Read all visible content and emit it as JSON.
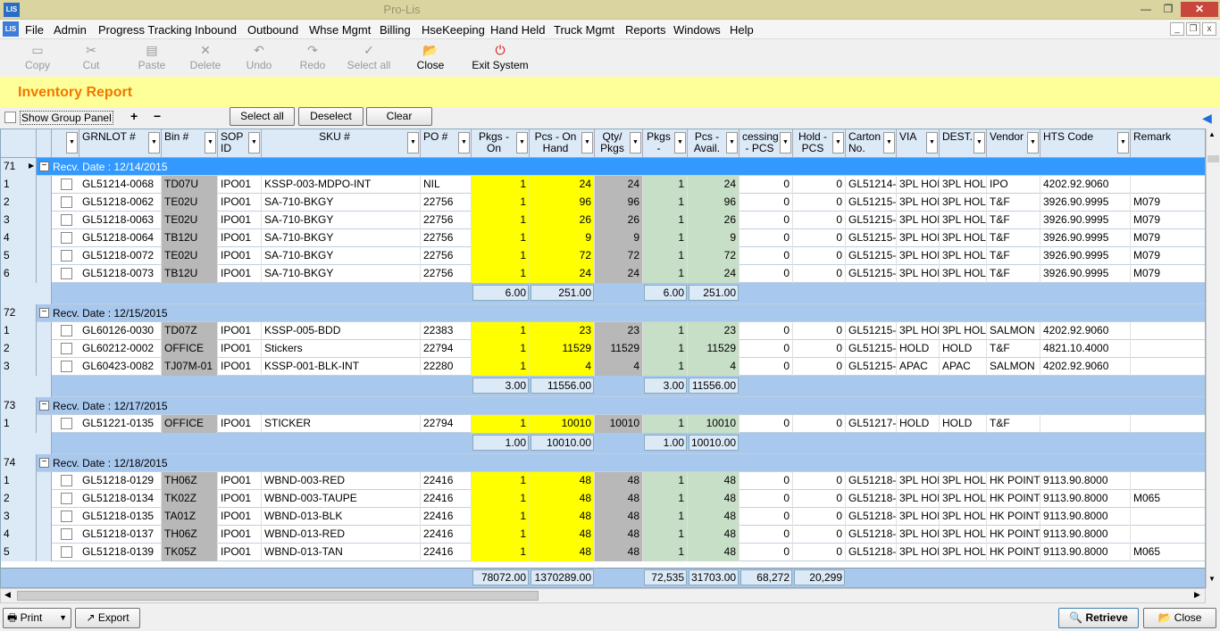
{
  "window": {
    "title": "Pro-Lis",
    "min": "—",
    "max": "❐",
    "close": "✕"
  },
  "menu": [
    "File",
    "Admin",
    "Progress Tracking",
    "Inbound",
    "Outbound",
    "Whse Mgmt",
    "Billing",
    "HseKeeping",
    "Hand Held",
    "Truck Mgmt",
    "Reports",
    "Windows",
    "Help"
  ],
  "toolbar": [
    {
      "label": "Copy",
      "icon": "▭"
    },
    {
      "label": "Cut",
      "icon": "✂"
    },
    {
      "label": "Paste",
      "icon": "▤"
    },
    {
      "label": "Delete",
      "icon": "✕"
    },
    {
      "label": "Undo",
      "icon": "↶"
    },
    {
      "label": "Redo",
      "icon": "↷"
    },
    {
      "label": "Select all",
      "icon": "✓"
    },
    {
      "label": "Close",
      "icon": "📂"
    },
    {
      "label": "Exit System",
      "icon": "⏻"
    }
  ],
  "report": {
    "title": "Inventory Report"
  },
  "options": {
    "group_panel": "Show Group Panel",
    "select_all": "Select all",
    "deselect": "Deselect",
    "clear": "Clear",
    "expand": "+",
    "collapse": "−"
  },
  "columns": [
    "",
    "GRNLOT #",
    "Bin #",
    "SOP ID",
    "SKU #",
    "PO #",
    "Pkgs - On",
    "Pcs - On Hand",
    "Qty/ Pkgs",
    "Pkgs -",
    "Pcs - Avail.",
    "cessing - PCS",
    "Hold - PCS",
    "Carton No.",
    "VIA",
    "DEST.",
    "Vendor",
    "HTS Code",
    "Remark"
  ],
  "groups": [
    {
      "num": "71",
      "label": "Recv. Date : 12/14/2015",
      "selected": true,
      "rows": [
        [
          "1",
          "GL51214-0068",
          "TD07U",
          "IPO01",
          "KSSP-003-MDPO-INT",
          "NIL",
          "1",
          "24",
          "24",
          "1",
          "24",
          "0",
          "0",
          "GL51214-",
          "3PL HOL",
          "3PL HOL",
          "IPO",
          "4202.92.9060",
          ""
        ],
        [
          "2",
          "GL51218-0062",
          "TE02U",
          "IPO01",
          "SA-710-BKGY",
          "22756",
          "1",
          "96",
          "96",
          "1",
          "96",
          "0",
          "0",
          "GL51215-",
          "3PL HOL",
          "3PL HOL",
          "T&F",
          "3926.90.9995",
          "M079"
        ],
        [
          "3",
          "GL51218-0063",
          "TE02U",
          "IPO01",
          "SA-710-BKGY",
          "22756",
          "1",
          "26",
          "26",
          "1",
          "26",
          "0",
          "0",
          "GL51215-",
          "3PL HOL",
          "3PL HOL",
          "T&F",
          "3926.90.9995",
          "M079"
        ],
        [
          "4",
          "GL51218-0064",
          "TB12U",
          "IPO01",
          "SA-710-BKGY",
          "22756",
          "1",
          "9",
          "9",
          "1",
          "9",
          "0",
          "0",
          "GL51215-",
          "3PL HOL",
          "3PL HOL",
          "T&F",
          "3926.90.9995",
          "M079"
        ],
        [
          "5",
          "GL51218-0072",
          "TE02U",
          "IPO01",
          "SA-710-BKGY",
          "22756",
          "1",
          "72",
          "72",
          "1",
          "72",
          "0",
          "0",
          "GL51215-",
          "3PL HOL",
          "3PL HOL",
          "T&F",
          "3926.90.9995",
          "M079"
        ],
        [
          "6",
          "GL51218-0073",
          "TB12U",
          "IPO01",
          "SA-710-BKGY",
          "22756",
          "1",
          "24",
          "24",
          "1",
          "24",
          "0",
          "0",
          "GL51215-",
          "3PL HOL",
          "3PL HOL",
          "T&F",
          "3926.90.9995",
          "M079"
        ]
      ],
      "summary": {
        "pkgs_on": "6.00",
        "pcs_on": "251.00",
        "pkgs_av": "6.00",
        "pcs_av": "251.00"
      }
    },
    {
      "num": "72",
      "label": "Recv. Date : 12/15/2015",
      "selected": false,
      "rows": [
        [
          "1",
          "GL60126-0030",
          "TD07Z",
          "IPO01",
          "KSSP-005-BDD",
          "22383",
          "1",
          "23",
          "23",
          "1",
          "23",
          "0",
          "0",
          "GL51215-",
          "3PL HOL",
          "3PL HOL",
          "SALMON",
          "4202.92.9060",
          ""
        ],
        [
          "2",
          "GL60212-0002",
          "OFFICE",
          "IPO01",
          "Stickers",
          "22794",
          "1",
          "11529",
          "11529",
          "1",
          "11529",
          "0",
          "0",
          "GL51215-",
          "HOLD",
          "HOLD",
          "T&F",
          "4821.10.4000",
          ""
        ],
        [
          "3",
          "GL60423-0082",
          "TJ07M-01",
          "IPO01",
          "KSSP-001-BLK-INT",
          "22280",
          "1",
          "4",
          "4",
          "1",
          "4",
          "0",
          "0",
          "GL51215-",
          "APAC",
          "APAC",
          "SALMON",
          "4202.92.9060",
          ""
        ]
      ],
      "summary": {
        "pkgs_on": "3.00",
        "pcs_on": "11556.00",
        "pkgs_av": "3.00",
        "pcs_av": "11556.00"
      }
    },
    {
      "num": "73",
      "label": "Recv. Date : 12/17/2015",
      "selected": false,
      "rows": [
        [
          "1",
          "GL51221-0135",
          "OFFICE",
          "IPO01",
          "STICKER",
          "22794",
          "1",
          "10010",
          "10010",
          "1",
          "10010",
          "0",
          "0",
          "GL51217-",
          "HOLD",
          "HOLD",
          "T&F",
          "",
          ""
        ]
      ],
      "summary": {
        "pkgs_on": "1.00",
        "pcs_on": "10010.00",
        "pkgs_av": "1.00",
        "pcs_av": "10010.00"
      }
    },
    {
      "num": "74",
      "label": "Recv. Date : 12/18/2015",
      "selected": false,
      "rows": [
        [
          "1",
          "GL51218-0129",
          "TH06Z",
          "IPO01",
          "WBND-003-RED",
          "22416",
          "1",
          "48",
          "48",
          "1",
          "48",
          "0",
          "0",
          "GL51218-",
          "3PL HOL",
          "3PL HOL",
          "HK POINT",
          "9113.90.8000",
          ""
        ],
        [
          "2",
          "GL51218-0134",
          "TK02Z",
          "IPO01",
          "WBND-003-TAUPE",
          "22416",
          "1",
          "48",
          "48",
          "1",
          "48",
          "0",
          "0",
          "GL51218-",
          "3PL HOL",
          "3PL HOL",
          "HK POINT",
          "9113.90.8000",
          "M065"
        ],
        [
          "3",
          "GL51218-0135",
          "TA01Z",
          "IPO01",
          "WBND-013-BLK",
          "22416",
          "1",
          "48",
          "48",
          "1",
          "48",
          "0",
          "0",
          "GL51218-",
          "3PL HOL",
          "3PL HOL",
          "HK POINT",
          "9113.90.8000",
          ""
        ],
        [
          "4",
          "GL51218-0137",
          "TH06Z",
          "IPO01",
          "WBND-013-RED",
          "22416",
          "1",
          "48",
          "48",
          "1",
          "48",
          "0",
          "0",
          "GL51218-",
          "3PL HOL",
          "3PL HOL",
          "HK POINT",
          "9113.90.8000",
          ""
        ],
        [
          "5",
          "GL51218-0139",
          "TK05Z",
          "IPO01",
          "WBND-013-TAN",
          "22416",
          "1",
          "48",
          "48",
          "1",
          "48",
          "0",
          "0",
          "GL51218-",
          "3PL HOL",
          "3PL HOL",
          "HK POINT",
          "9113.90.8000",
          "M065"
        ]
      ],
      "summary": null
    }
  ],
  "footer": {
    "pkgs_on": "78072.00",
    "pcs_on": "1370289.00",
    "pkgs_av": "72,535",
    "pcs_av": "31703.00",
    "processing": "68,272",
    "hold": "20,299"
  },
  "bottom": {
    "print": "Print",
    "export": "Export",
    "retrieve": "Retrieve",
    "close": "Close"
  }
}
